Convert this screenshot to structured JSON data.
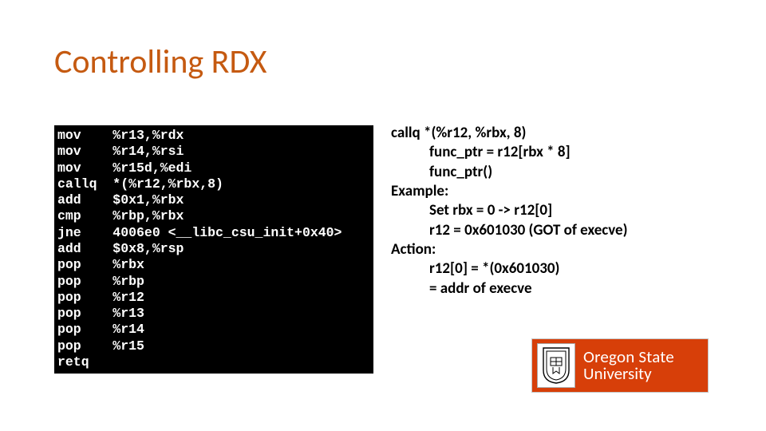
{
  "title": "Controlling RDX",
  "asm": [
    "mov    %r13,%rdx",
    "mov    %r14,%rsi",
    "mov    %r15d,%edi",
    "callq  *(%r12,%rbx,8)",
    "add    $0x1,%rbx",
    "cmp    %rbp,%rbx",
    "jne    4006e0 <__libc_csu_init+0x40>",
    "add    $0x8,%rsp",
    "pop    %rbx",
    "pop    %rbp",
    "pop    %r12",
    "pop    %r13",
    "pop    %r14",
    "pop    %r15",
    "retq"
  ],
  "notes": [
    {
      "text": "callq *(%r12, %rbx, 8)",
      "indent": false
    },
    {
      "text": "func_ptr = r12[rbx * 8]",
      "indent": true
    },
    {
      "text": "func_ptr()",
      "indent": true
    },
    {
      "text": "Example:",
      "indent": false
    },
    {
      "text": "Set rbx = 0 -> r12[0]",
      "indent": true
    },
    {
      "text": "r12 = 0x601030 (GOT of execve)",
      "indent": true
    },
    {
      "text": "Action:",
      "indent": false
    },
    {
      "text": "r12[0] = *(0x601030)",
      "indent": true
    },
    {
      "text": "= addr of execve",
      "indent": true
    }
  ],
  "logo": {
    "line1": "Oregon State",
    "line2": "University"
  }
}
